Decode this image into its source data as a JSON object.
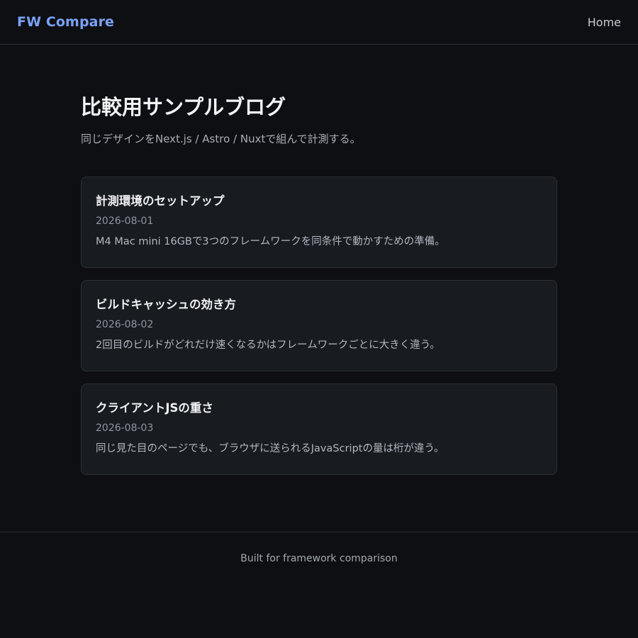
{
  "header": {
    "brand": "FW Compare",
    "nav_home": "Home"
  },
  "main": {
    "title": "比較用サンプルブログ",
    "subtitle": "同じデザインをNext.js / Astro / Nuxtで組んで計測する。",
    "posts": [
      {
        "title": "計測環境のセットアップ",
        "date": "2026-08-01",
        "excerpt": "M4 Mac mini 16GBで3つのフレームワークを同条件で動かすための準備。"
      },
      {
        "title": "ビルドキャッシュの効き方",
        "date": "2026-08-02",
        "excerpt": "2回目のビルドがどれだけ速くなるかはフレームワークごとに大きく違う。"
      },
      {
        "title": "クライアントJSの重さ",
        "date": "2026-08-03",
        "excerpt": "同じ見た目のページでも、ブラウザに送られるJavaScriptの量は桁が違う。"
      }
    ]
  },
  "footer": {
    "text": "Built for framework comparison"
  },
  "colors": {
    "background": "#0e0f13",
    "brand_accent": "#7aa2f7",
    "card_background": "#181b20"
  }
}
